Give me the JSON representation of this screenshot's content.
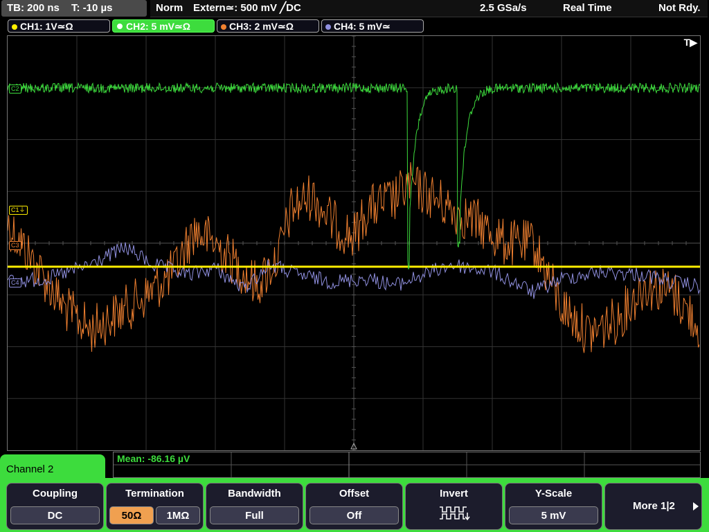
{
  "status": {
    "timebase": "TB: 200 ns",
    "trigger_time": "T: -10 µs",
    "trigger_mode": "Norm",
    "trigger_source": "Extern≃: 500 mV ╱DC",
    "sample_rate": "2.5 GSa/s",
    "acq_mode": "Real Time",
    "state": "Not Rdy."
  },
  "channels": [
    {
      "label": "CH1: 1V≃Ω",
      "color": "#ffee00"
    },
    {
      "label": "CH2: 5 mV≃Ω",
      "color": "#3ddc3d"
    },
    {
      "label": "CH3: 2 mV≃Ω",
      "color": "#f08030"
    },
    {
      "label": "CH4: 5 mV≃",
      "color": "#9090e0"
    }
  ],
  "markers": {
    "c1": "C1⏚",
    "c2": "C2",
    "c3": "C3",
    "c4": "C4",
    "trigger": "T▶"
  },
  "measurement": "Mean: -86.16 µV",
  "channel_panel": "Channel 2",
  "softkeys": {
    "coupling": {
      "title": "Coupling",
      "value": "DC"
    },
    "termination": {
      "title": "Termination",
      "value_50": "50Ω",
      "value_1m": "1MΩ"
    },
    "bandwidth": {
      "title": "Bandwidth",
      "value": "Full"
    },
    "offset": {
      "title": "Offset",
      "value": "Off"
    },
    "invert": {
      "title": "Invert",
      "icon": "invert-wave-icon"
    },
    "yscale": {
      "title": "Y-Scale",
      "value": "5 mV"
    },
    "more": {
      "label": "More 1|2"
    }
  }
}
